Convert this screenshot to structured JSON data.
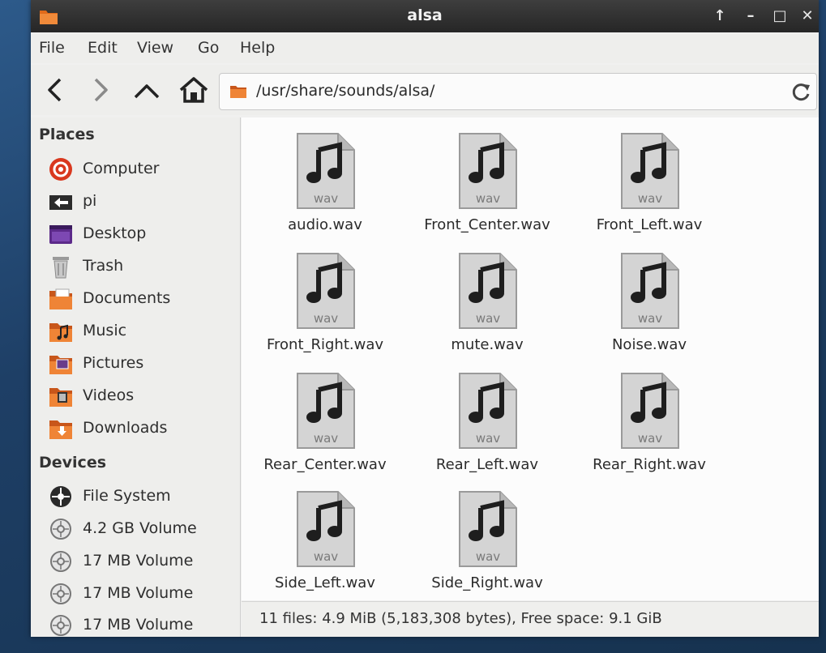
{
  "window": {
    "title": "alsa"
  },
  "window_controls": {
    "up": "↑",
    "minimize": "–",
    "maximize": "□",
    "close": "✕"
  },
  "menu": [
    "File",
    "Edit",
    "View",
    "Go",
    "Help"
  ],
  "location": {
    "path": "/usr/share/sounds/alsa/"
  },
  "sidebar": {
    "places_title": "Places",
    "places": [
      {
        "label": "Computer",
        "icon": "computer-icon"
      },
      {
        "label": "pi",
        "icon": "home-folder-icon"
      },
      {
        "label": "Desktop",
        "icon": "desktop-icon"
      },
      {
        "label": "Trash",
        "icon": "trash-icon"
      },
      {
        "label": "Documents",
        "icon": "documents-folder-icon"
      },
      {
        "label": "Music",
        "icon": "music-folder-icon"
      },
      {
        "label": "Pictures",
        "icon": "pictures-folder-icon"
      },
      {
        "label": "Videos",
        "icon": "videos-folder-icon"
      },
      {
        "label": "Downloads",
        "icon": "downloads-folder-icon"
      }
    ],
    "devices_title": "Devices",
    "devices": [
      {
        "label": "File System",
        "icon": "filesystem-icon"
      },
      {
        "label": "4.2 GB Volume",
        "icon": "volume-icon"
      },
      {
        "label": "17 MB Volume",
        "icon": "volume-icon"
      },
      {
        "label": "17 MB Volume",
        "icon": "volume-icon"
      },
      {
        "label": "17 MB Volume",
        "icon": "volume-icon"
      }
    ]
  },
  "files": [
    {
      "name": "audio.wav",
      "badge": "wav"
    },
    {
      "name": "Front_Center.wav",
      "badge": "wav"
    },
    {
      "name": "Front_Left.wav",
      "badge": "wav"
    },
    {
      "name": "Front_Right.wav",
      "badge": "wav"
    },
    {
      "name": "mute.wav",
      "badge": "wav"
    },
    {
      "name": "Noise.wav",
      "badge": "wav"
    },
    {
      "name": "Rear_Center.wav",
      "badge": "wav"
    },
    {
      "name": "Rear_Left.wav",
      "badge": "wav"
    },
    {
      "name": "Rear_Right.wav",
      "badge": "wav"
    },
    {
      "name": "Side_Left.wav",
      "badge": "wav"
    },
    {
      "name": "Side_Right.wav",
      "badge": "wav"
    }
  ],
  "status": {
    "text": "11 files: 4.9 MiB (5,183,308 bytes), Free space: 9.1 GiB"
  },
  "colors": {
    "folder_orange": "#e06a1b",
    "computer_red": "#d9381e",
    "titlebar": "#2e2e2e"
  }
}
